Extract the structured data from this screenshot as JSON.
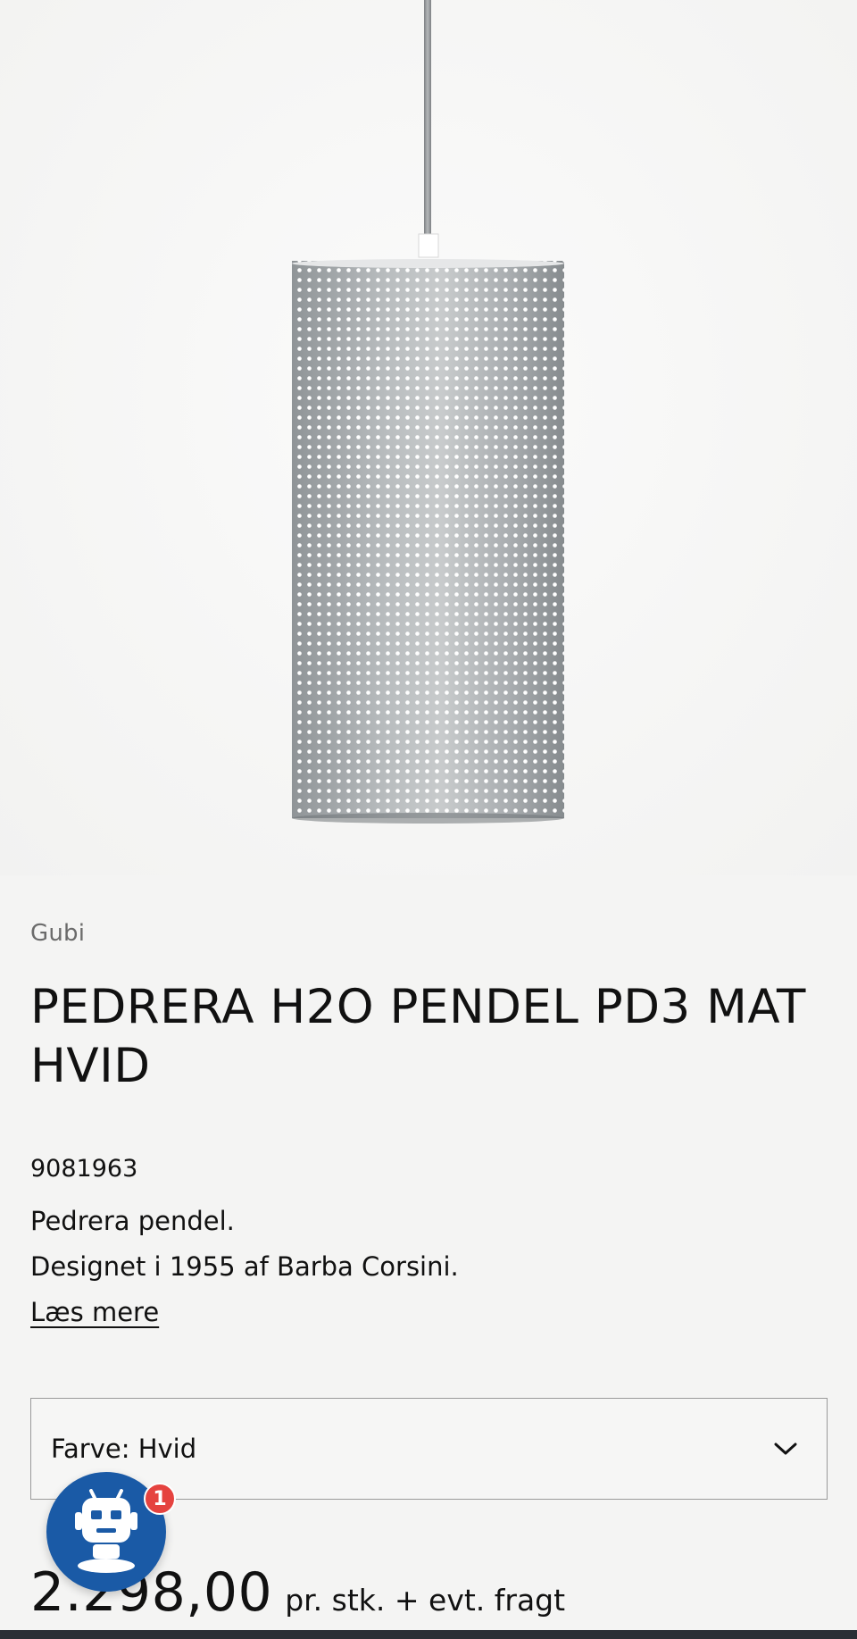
{
  "product": {
    "brand": "Gubi",
    "title": "PEDRERA H2O PENDEL PD3 MAT HVID",
    "sku": "9081963",
    "description_lines": [
      "Pedrera pendel.",
      "Designet i 1955 af Barba Corsini."
    ],
    "read_more": "Læs mere",
    "image_alt": "pendant-lamp-photo"
  },
  "variant_select": {
    "label": "Farve: Hvid",
    "icon": "chevron-down-icon"
  },
  "pricing": {
    "price": "2.298,00",
    "note": "pr. stk. + evt. fragt"
  },
  "chat_widget": {
    "icon": "robot-icon",
    "badge_count": "1",
    "color": "#1a5aa6",
    "badge_color": "#e5433f"
  }
}
